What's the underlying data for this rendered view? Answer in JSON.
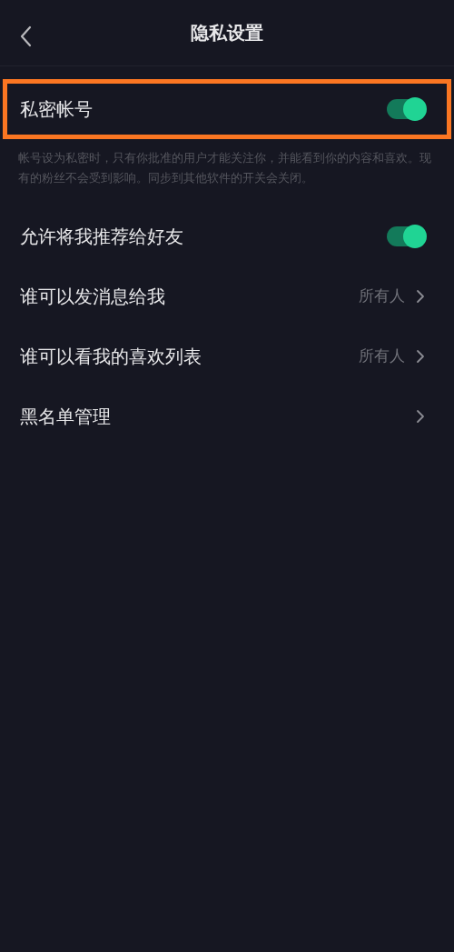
{
  "header": {
    "title": "隐私设置"
  },
  "settings": [
    {
      "kind": "toggle",
      "label": "私密帐号",
      "on": true,
      "highlighted": true,
      "description": "帐号设为私密时，只有你批准的用户才能关注你，并能看到你的内容和喜欢。现有的粉丝不会受到影响。同步到其他软件的开关会关闭。"
    },
    {
      "kind": "toggle",
      "label": "允许将我推荐给好友",
      "on": true,
      "highlighted": false
    },
    {
      "kind": "link",
      "label": "谁可以发消息给我",
      "value": "所有人",
      "highlighted": false
    },
    {
      "kind": "link",
      "label": "谁可以看我的喜欢列表",
      "value": "所有人",
      "highlighted": false
    },
    {
      "kind": "link",
      "label": "黑名单管理",
      "highlighted": false
    }
  ]
}
